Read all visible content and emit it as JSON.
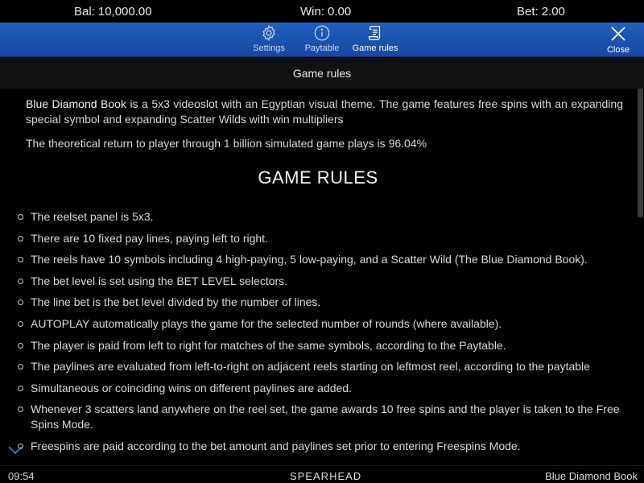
{
  "status": {
    "balance_label": "Bal:",
    "balance_value": "10,000.00",
    "win_label": "Win:",
    "win_value": "0.00",
    "bet_label": "Bet:",
    "bet_value": "2.00"
  },
  "toolbar": {
    "settings_label": "Settings",
    "paytable_label": "Paytable",
    "rules_label": "Game rules",
    "close_label": "Close",
    "accent_color": "#1c56b4"
  },
  "section": {
    "title": "Game rules"
  },
  "content": {
    "game_name": "Blue Diamond Book",
    "intro_rest": " is a 5x3 videoslot with an Egyptian visual theme. The game features free spins with an expanding special symbol and expanding Scatter Wilds with win multipliers",
    "rtp": "The theoretical return to player through 1 billion simulated game plays is 96.04%",
    "heading": "GAME RULES",
    "rules": [
      "The reelset panel is 5x3.",
      "There are 10 fixed pay lines, paying left to right.",
      "The reels have 10 symbols including 4 high-paying, 5 low-paying, and a Scatter Wild (The Blue Diamond Book).",
      "The bet level is set using the BET LEVEL selectors.",
      "The line bet is the bet level divided by the number of lines.",
      "AUTOPLAY automatically plays the game for the selected number of rounds (where available).",
      "The player is paid from left to right for matches of the same symbols, according to the Paytable.",
      "The paylines are evaluated from left-to-right on adjacent reels starting on leftmost reel, according to the paytable",
      "Simultaneous or coinciding wins on different paylines are added.",
      "Whenever 3 scatters land anywhere on the reel set, the game awards 10 free spins and the player is taken to the Free Spins Mode.",
      "Freespins are paid according to the bet amount and paylines set prior to entering Freespins Mode."
    ]
  },
  "footer": {
    "clock": "09:54",
    "brand": "SPEARHEAD",
    "game_name": "Blue Diamond Book"
  }
}
